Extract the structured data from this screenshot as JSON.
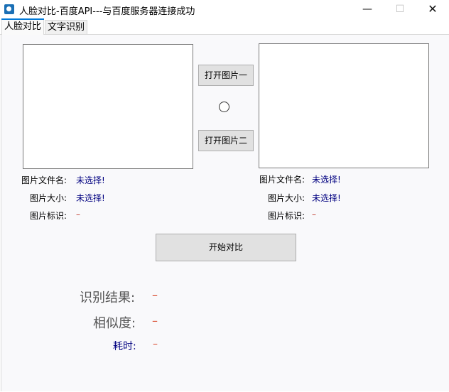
{
  "window": {
    "title": "人脸对比-百度API---与百度服务器连接成功",
    "minimize_glyph": "—",
    "maximize_glyph": "☐",
    "close_glyph": "✕"
  },
  "tabs": [
    {
      "label": "人脸对比",
      "active": true
    },
    {
      "label": "文字识别",
      "active": false
    }
  ],
  "buttons": {
    "open_image_1": "打开图片一",
    "open_image_2": "打开图片二",
    "start_compare": "开始对比"
  },
  "left_image": {
    "file_name_label": "图片文件名:",
    "file_name_value": "未选择!",
    "size_label": "图片大小:",
    "size_value": "未选择!",
    "tag_label": "图片标识:",
    "tag_value": "–"
  },
  "right_image": {
    "file_name_label": "图片文件名:",
    "file_name_value": "未选择!",
    "size_label": "图片大小:",
    "size_value": "未选择!",
    "tag_label": "图片标识:",
    "tag_value": "–"
  },
  "results": {
    "result_label": "识别结果:",
    "result_value": "–",
    "similarity_label": "相似度:",
    "similarity_value": "–",
    "time_label": "耗时:",
    "time_value": "–"
  },
  "colors": {
    "accent": "#0078d7",
    "value_text": "#000080",
    "dash": "#d9482b"
  }
}
